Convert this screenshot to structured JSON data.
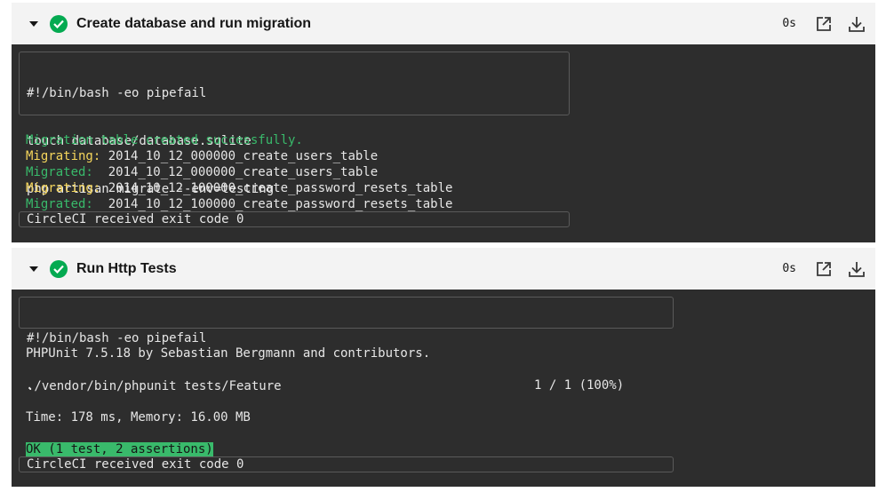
{
  "steps": [
    {
      "title": "Create database and run migration",
      "duration": "0s",
      "commands": [
        "#!/bin/bash -eo pipefail",
        "touch database/database.sqlite",
        "php artisan migrate --env=testing"
      ],
      "output": [
        {
          "prefix": "Migration table created successfully.",
          "text": ""
        },
        {
          "prefix": "Migrating:",
          "text": " 2014_10_12_000000_create_users_table"
        },
        {
          "prefix": "Migrated:",
          "text": "  2014_10_12_000000_create_users_table"
        },
        {
          "prefix": "Migrating:",
          "text": " 2014_10_12_100000_create_password_resets_table"
        },
        {
          "prefix": "Migrated:",
          "text": "  2014_10_12_100000_create_password_resets_table"
        }
      ],
      "exit": "CircleCI received exit code 0"
    },
    {
      "title": "Run Http Tests",
      "duration": "0s",
      "commands": [
        "#!/bin/bash -eo pipefail",
        "./vendor/bin/phpunit tests/Feature"
      ],
      "output": [
        "PHPUnit 7.5.18 by Sebastian Bergmann and contributors.",
        ".",
        "1 / 1 (100%)",
        "Time: 178 ms, Memory: 16.00 MB",
        "OK (1 test, 2 assertions)"
      ],
      "exit": "CircleCI received exit code 0"
    }
  ],
  "colors": {
    "success": "#04aa51",
    "terminal_bg": "#2d2d2d",
    "green_text": "#39ba6b",
    "yellow_text": "#f5d65c"
  },
  "icons": [
    "chevron-down-icon",
    "check-circle-icon",
    "external-link-icon",
    "download-icon"
  ]
}
